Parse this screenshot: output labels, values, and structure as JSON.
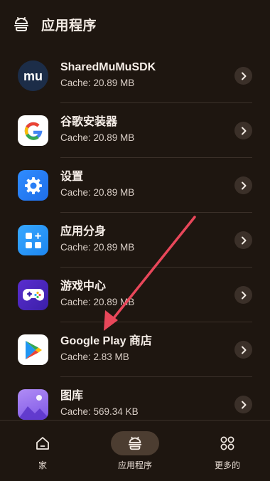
{
  "header": {
    "title": "应用程序",
    "icon": "android-robot-icon"
  },
  "apps": [
    {
      "name": "SharedMuMuSDK",
      "cache": "Cache: 20.89 MB",
      "icon": "mumu-logo-icon"
    },
    {
      "name": "谷歌安装器",
      "cache": "Cache: 20.89 MB",
      "icon": "google-g-icon"
    },
    {
      "name": "设置",
      "cache": "Cache: 20.89 MB",
      "icon": "settings-gear-icon"
    },
    {
      "name": "应用分身",
      "cache": "Cache: 20.89 MB",
      "icon": "app-clone-icon"
    },
    {
      "name": "游戏中心",
      "cache": "Cache: 20.89 MB",
      "icon": "game-controller-icon"
    },
    {
      "name": "Google Play 商店",
      "cache": "Cache: 2.83 MB",
      "icon": "google-play-icon"
    },
    {
      "name": "图库",
      "cache": "Cache: 569.34 KB",
      "icon": "gallery-icon"
    }
  ],
  "nav": [
    {
      "label": "家",
      "icon": "home-icon"
    },
    {
      "label": "应用程序",
      "icon": "android-robot-icon"
    },
    {
      "label": "更多的",
      "icon": "more-grid-icon"
    }
  ],
  "colors": {
    "background": "#1e1610",
    "divider": "#3b3029",
    "chevron_bg": "#3b3029",
    "active_nav_bg": "#4c3d31",
    "annotation_arrow": "#e8475a"
  }
}
